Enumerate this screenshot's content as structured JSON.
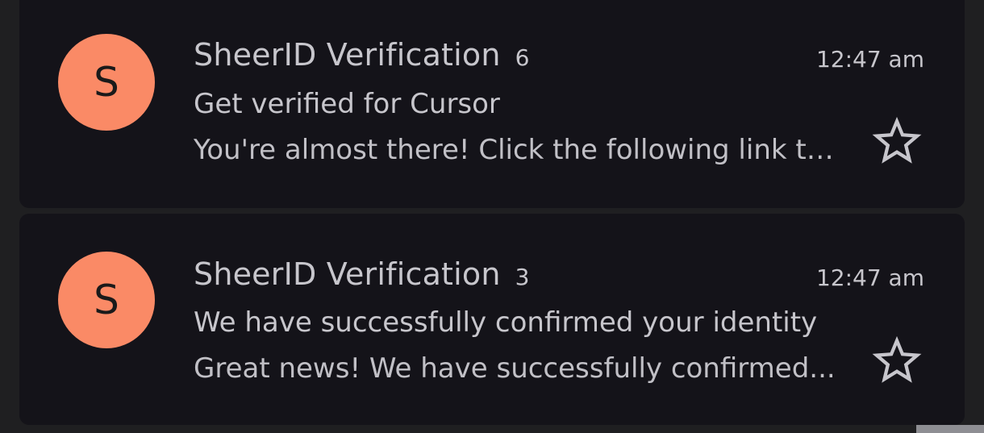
{
  "colors": {
    "background": "#1f1f21",
    "card": "#141319",
    "avatar": "#fa8a66",
    "text": "#c7c6cc"
  },
  "emails": [
    {
      "avatar_letter": "S",
      "sender": "SheerID Verification",
      "count": "6",
      "time": "12:47 am",
      "subject": "Get verified for Cursor",
      "snippet": "You're almost there! Click the following link to...",
      "star_icon": "star-outline-icon"
    },
    {
      "avatar_letter": "S",
      "sender": "SheerID Verification",
      "count": "3",
      "time": "12:47 am",
      "subject": "We have successfully confirmed your identity",
      "snippet": "Great news! We have successfully confirmed...",
      "star_icon": "star-outline-icon"
    }
  ]
}
